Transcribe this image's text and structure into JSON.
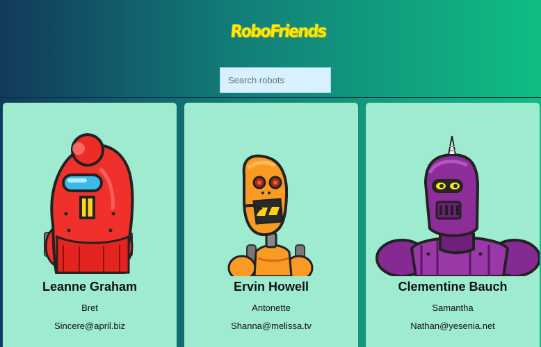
{
  "app": {
    "logo": "RoboFriends"
  },
  "search": {
    "placeholder": "Search robots",
    "value": ""
  },
  "robots": [
    {
      "name": "Leanne Graham",
      "username": "Bret",
      "email": "Sincere@april.biz",
      "avatar": "red-robot-avatar"
    },
    {
      "name": "Ervin Howell",
      "username": "Antonette",
      "email": "Shanna@melissa.tv",
      "avatar": "orange-robot-avatar"
    },
    {
      "name": "Clementine Bauch",
      "username": "Samantha",
      "email": "Nathan@yesenia.net",
      "avatar": "purple-robot-avatar"
    }
  ],
  "colors": {
    "gradient_left": "#113a5b",
    "gradient_mid": "#127f79",
    "gradient_right": "#10bd83",
    "card_background": "#9eebd0",
    "logo_yellow": "#ffe600",
    "search_background": "#d8f1ff"
  }
}
